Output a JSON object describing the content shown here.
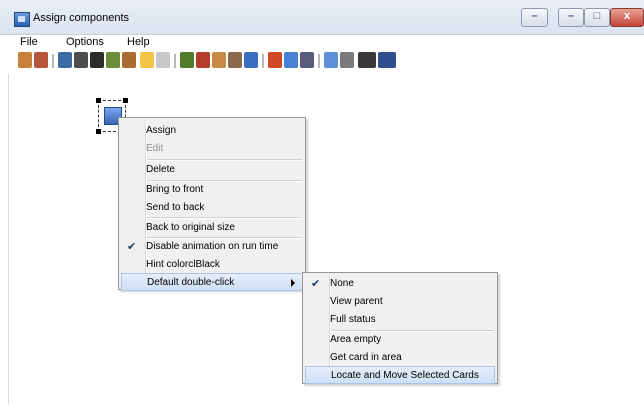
{
  "window": {
    "title": "Assign components",
    "controls": [
      "minimize",
      "maximize",
      "close"
    ],
    "close_symbol": "x"
  },
  "menubar": [
    "File",
    "Options",
    "Help"
  ],
  "toolbar_icons": [
    "people-icon",
    "people-alt-icon",
    "dock-icon",
    "statue-icon",
    "card-icon",
    "stack-icon",
    "box-icon",
    "lightbulb-icon",
    "cylinder-icon",
    "book-green-icon",
    "book-red-icon",
    "people-group-icon",
    "stack-tray-icon",
    "window-icon",
    "pencil-icon",
    "picture-icon",
    "person-icon",
    "monitor-icon",
    "gears-icon",
    "tape-icon",
    "screen-icon"
  ],
  "context_menu": {
    "items": [
      "Assign",
      "Edit",
      "Delete",
      "Bring to front",
      "Send to back",
      "Back to original size",
      "Disable animation on run time",
      "Hint colorclBlack",
      "Default double-click"
    ],
    "checked": "Disable animation on run time",
    "disabled": "Edit",
    "active": "Default double-click"
  },
  "submenu": {
    "items": [
      "None",
      "View parent",
      "Full status",
      "Area empty",
      "Get card in area",
      "Locate and Move Selected Cards"
    ],
    "checked": "None",
    "highlighted": "Locate and Move Selected Cards"
  }
}
